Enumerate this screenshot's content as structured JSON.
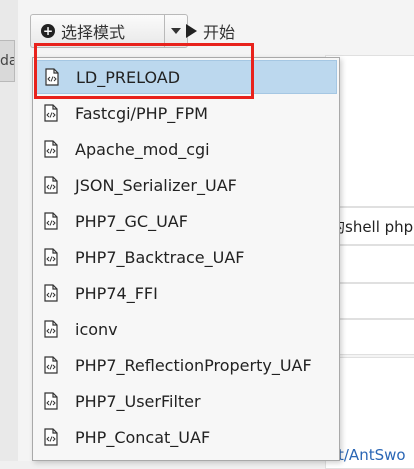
{
  "left_tab": {
    "text": "da"
  },
  "toolbar": {
    "mode_label": "选择模式",
    "start_label": "开始"
  },
  "background": {
    "text_line": "的shell php",
    "link_text": "t/AntSwo"
  },
  "menu": {
    "selected_index": 0,
    "items": [
      {
        "label": "LD_PRELOAD"
      },
      {
        "label": "Fastcgi/PHP_FPM"
      },
      {
        "label": "Apache_mod_cgi"
      },
      {
        "label": "JSON_Serializer_UAF"
      },
      {
        "label": "PHP7_GC_UAF"
      },
      {
        "label": "PHP7_Backtrace_UAF"
      },
      {
        "label": "PHP74_FFI"
      },
      {
        "label": "iconv"
      },
      {
        "label": "PHP7_ReflectionProperty_UAF"
      },
      {
        "label": "PHP7_UserFilter"
      },
      {
        "label": "PHP_Concat_UAF"
      }
    ]
  },
  "colors": {
    "highlight_border": "#e8221c",
    "selected_bg": "#bcd8ee"
  },
  "icons": [
    "plus-circle-icon",
    "chevron-down-icon",
    "play-icon",
    "code-file-icon"
  ]
}
